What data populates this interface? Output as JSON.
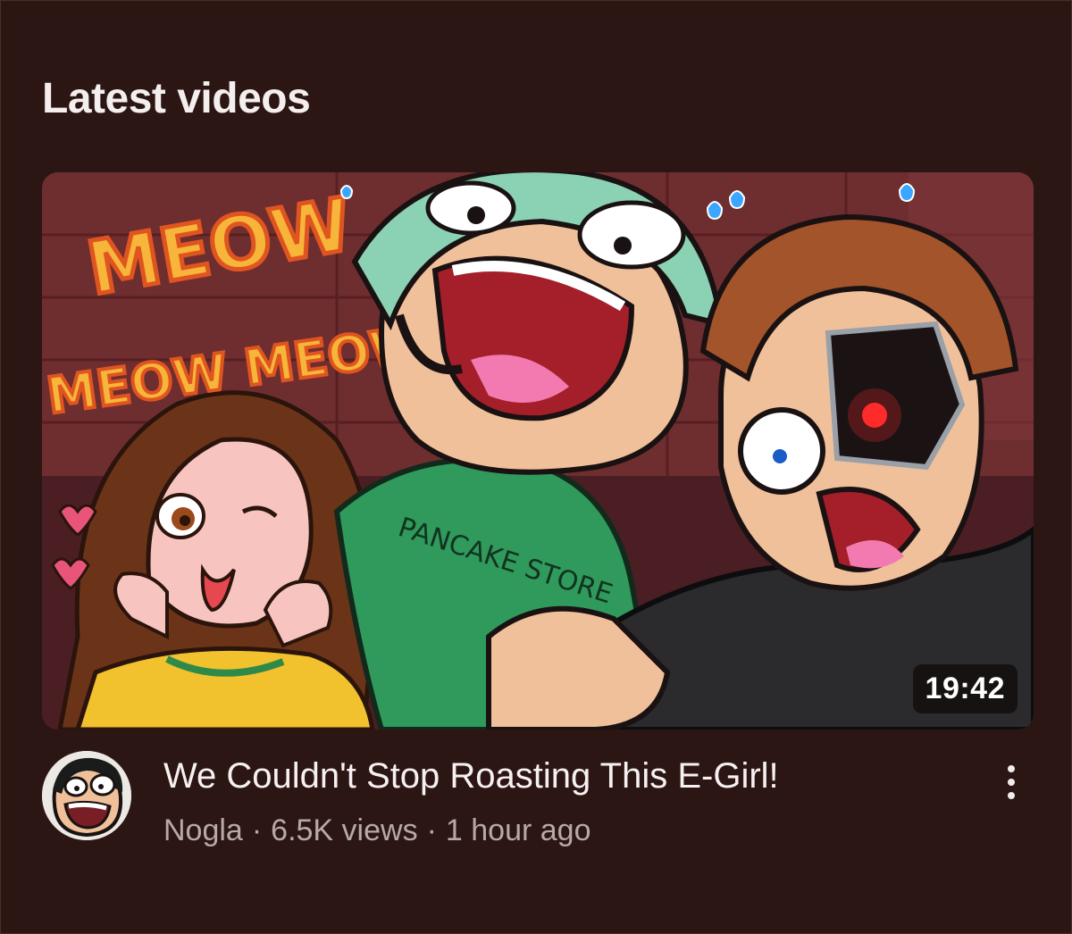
{
  "section": {
    "title": "Latest videos"
  },
  "video": {
    "thumbnail_text": {
      "meow_big": "MEOW",
      "meow_small": "MEOW MEOW",
      "shirt": "PANCAKE STORE"
    },
    "duration": "19:42",
    "title": "We Couldn't Stop Roasting This E-Girl!",
    "channel": "Nogla",
    "views": "6.5K views",
    "age": "1 hour ago",
    "separator": "·",
    "more_icon": "more-vertical-icon"
  },
  "colors": {
    "background": "#2c1614",
    "title_text": "#f6f1f0",
    "meta_text": "#b6a9a7",
    "meow_yellow": "#f7b53a",
    "meow_outline": "#e0551f"
  }
}
